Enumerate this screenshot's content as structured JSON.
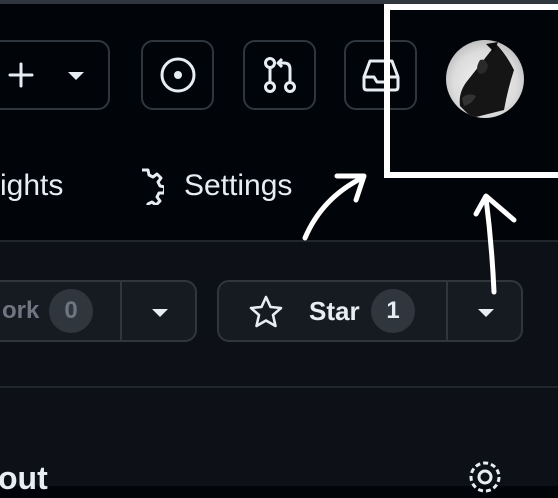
{
  "header": {
    "create_button": {
      "plus_icon": "plus-icon",
      "chevron_icon": "chevron-down-icon"
    },
    "issues_icon": "issue-opened-icon",
    "pull_requests_icon": "git-pull-request-icon",
    "inbox_icon": "inbox-icon",
    "avatar_icon": "user-avatar"
  },
  "repo_nav": {
    "insights_label": "ights",
    "settings_label": "Settings",
    "settings_icon": "gear-icon"
  },
  "actions": {
    "fork_label": "ork",
    "fork_count": "0",
    "star_label": "Star",
    "star_count": "1"
  },
  "about": {
    "heading": "out",
    "settings_icon": "gear-icon"
  },
  "colors": {
    "page_bg": "#010409",
    "section_bg": "#0d1117",
    "border": "#30363d",
    "button_bg": "#161b22",
    "text": "#e6edf3",
    "muted_text": "#6e7681",
    "annotation": "#ffffff"
  }
}
